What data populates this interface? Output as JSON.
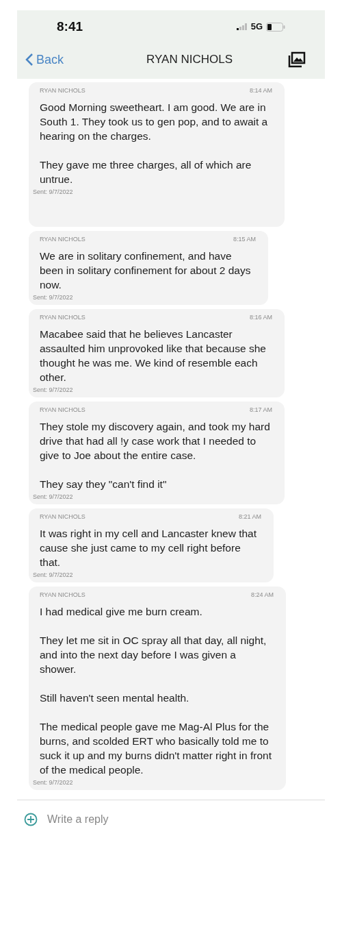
{
  "status_bar": {
    "time": "8:41",
    "network": "5G"
  },
  "nav": {
    "back": "Back",
    "title": "RYAN NICHOLS"
  },
  "messages": [
    {
      "sender": "RYAN NICHOLS",
      "time": "8:14 AM",
      "paragraphs": [
        "Good Morning sweetheart. I am good. We are in South 1. They took us to gen pop, and to await a hearing on the charges.",
        "They gave me three charges, all of which are untrue."
      ],
      "sent": "Sent: 9/7/2022"
    },
    {
      "sender": "RYAN NICHOLS",
      "time": "8:15 AM",
      "paragraphs": [
        "We are in solitary confinement, and have been in solitary confinement for about 2 days now."
      ],
      "sent": "Sent: 9/7/2022"
    },
    {
      "sender": "RYAN NICHOLS",
      "time": "8:16 AM",
      "paragraphs": [
        "Macabee said that he believes Lancaster assaulted him unprovoked like that because she thought he was me. We kind of resemble each other."
      ],
      "sent": "Sent: 9/7/2022"
    },
    {
      "sender": "RYAN NICHOLS",
      "time": "8:17 AM",
      "paragraphs": [
        "They stole my discovery again, and took my hard drive that had all !y case work that I needed to give to Joe about the entire case.",
        "They say they \"can't find it\""
      ],
      "sent": "Sent: 9/7/2022"
    },
    {
      "sender": "RYAN NICHOLS",
      "time": "8:21 AM",
      "paragraphs": [
        "It was right in my cell and Lancaster knew that cause she just came to my cell right before that."
      ],
      "sent": "Sent: 9/7/2022"
    },
    {
      "sender": "RYAN NICHOLS",
      "time": "8:24 AM",
      "paragraphs": [
        "I had medical give me burn cream.",
        "They let me sit in OC spray all that day, all night, and into the next day before I was given a shower.",
        "Still haven't seen mental health.",
        "The medical people gave me Mag-Al Plus for the burns, and scolded ERT who basically told me to suck it up and my burns didn't matter right in front of the medical people."
      ],
      "sent": "Sent: 9/7/2022"
    }
  ],
  "reply": {
    "placeholder": "Write a reply"
  }
}
